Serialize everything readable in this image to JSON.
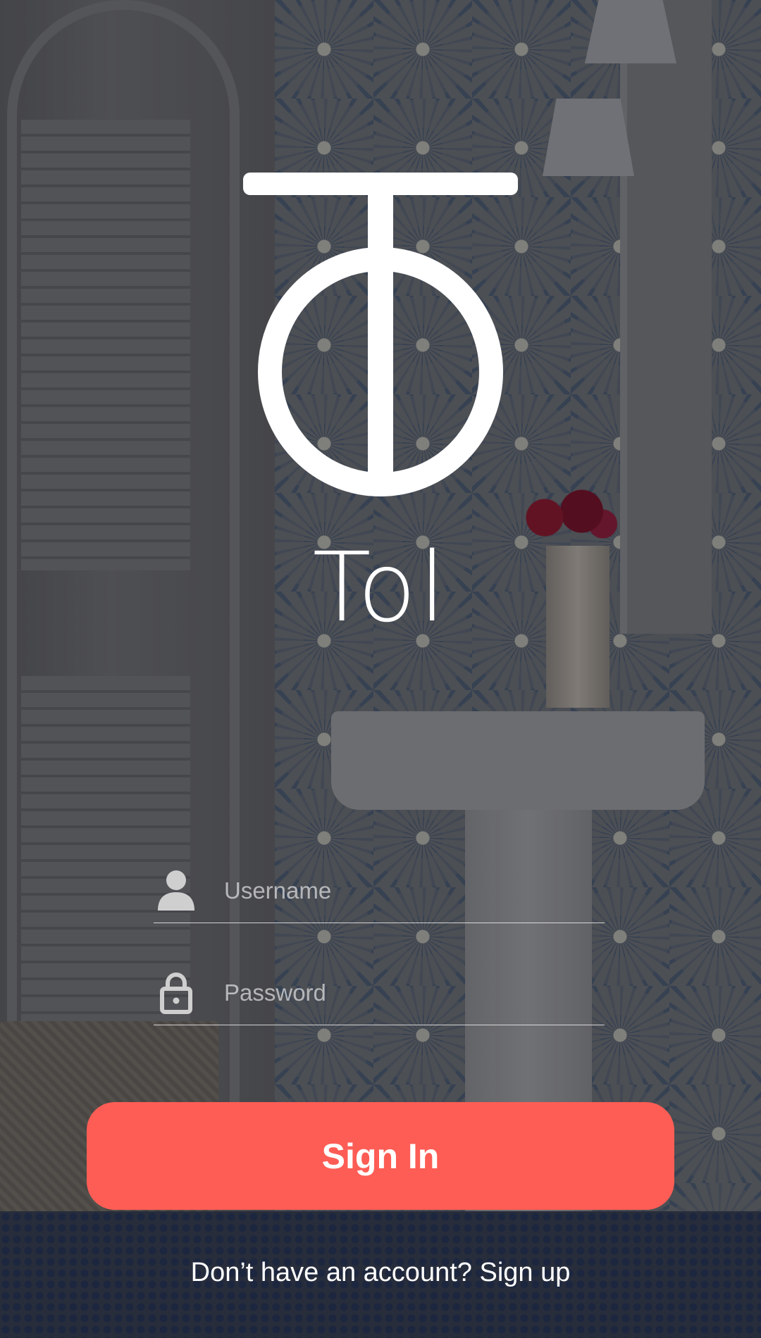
{
  "app": {
    "title": "Tol",
    "logo_icon": "tol-logo-icon"
  },
  "login": {
    "username_placeholder": "Username",
    "password_placeholder": "Password",
    "signin_label": "Sign In",
    "username_icon": "user-icon",
    "password_icon": "lock-icon"
  },
  "footer": {
    "prompt": "Don’t have an account?",
    "signup_label": "Sign up"
  },
  "colors": {
    "accent": "#fd5d55",
    "text": "#ffffff"
  }
}
